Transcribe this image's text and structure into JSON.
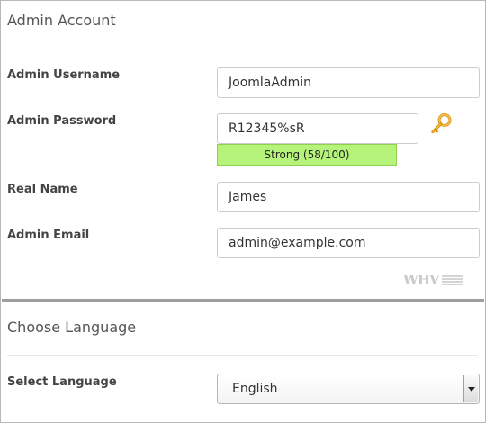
{
  "admin_section": {
    "title": "Admin Account",
    "username": {
      "label": "Admin Username",
      "value": "JoomlaAdmin"
    },
    "password": {
      "label": "Admin Password",
      "value": "R12345%sR",
      "strength": "Strong (58/100)"
    },
    "real_name": {
      "label": "Real Name",
      "value": "James"
    },
    "email": {
      "label": "Admin Email",
      "value": "admin@example.com"
    },
    "watermark": "WHV"
  },
  "language_section": {
    "title": "Choose Language",
    "select_label": "Select Language",
    "selected": "English"
  },
  "icons": {
    "generate_password": "key-icon",
    "dropdown": "chevron-down-icon"
  },
  "colors": {
    "strength_fill": "#b6f37a",
    "divider": "#9e9e9e",
    "key": "#e5a51c"
  }
}
